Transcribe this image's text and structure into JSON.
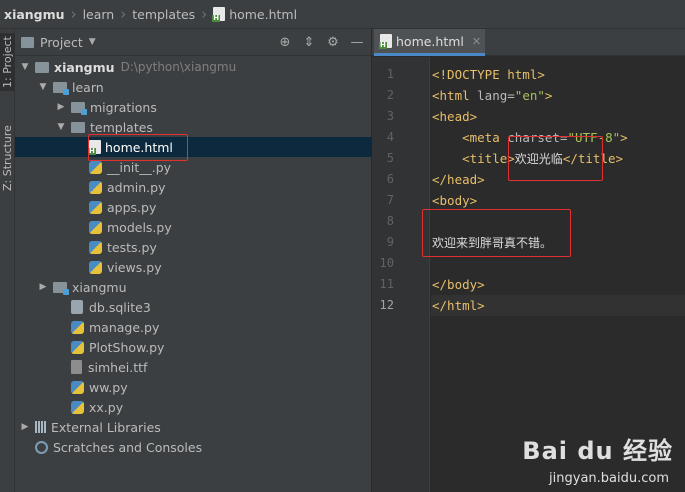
{
  "breadcrumb": [
    "xiangmu",
    "learn",
    "templates",
    "home.html"
  ],
  "tool_strip": {
    "project_tab": "1: Project",
    "structure_tab": "Z: Structure"
  },
  "project_panel": {
    "title": "Project",
    "tools": [
      "crosshair-icon",
      "collapse-icon",
      "gear-icon",
      "hide-icon"
    ]
  },
  "tree": [
    {
      "label": "xiangmu",
      "path": "D:\\python\\xiangmu",
      "indent": 0,
      "arrow": "down",
      "icon": "folder",
      "bold": true
    },
    {
      "label": "learn",
      "indent": 1,
      "arrow": "down",
      "icon": "folder-mod"
    },
    {
      "label": "migrations",
      "indent": 2,
      "arrow": "right",
      "icon": "folder-mod"
    },
    {
      "label": "templates",
      "indent": 2,
      "arrow": "down",
      "icon": "folder"
    },
    {
      "label": "home.html",
      "indent": 3,
      "arrow": "",
      "icon": "html",
      "selected": true
    },
    {
      "label": "__init__.py",
      "indent": 3,
      "arrow": "",
      "icon": "py"
    },
    {
      "label": "admin.py",
      "indent": 3,
      "arrow": "",
      "icon": "py"
    },
    {
      "label": "apps.py",
      "indent": 3,
      "arrow": "",
      "icon": "py"
    },
    {
      "label": "models.py",
      "indent": 3,
      "arrow": "",
      "icon": "py"
    },
    {
      "label": "tests.py",
      "indent": 3,
      "arrow": "",
      "icon": "py"
    },
    {
      "label": "views.py",
      "indent": 3,
      "arrow": "",
      "icon": "py"
    },
    {
      "label": "xiangmu",
      "indent": 1,
      "arrow": "right",
      "icon": "folder-mod"
    },
    {
      "label": "db.sqlite3",
      "indent": 2,
      "arrow": "",
      "icon": "db"
    },
    {
      "label": "manage.py",
      "indent": 2,
      "arrow": "",
      "icon": "py"
    },
    {
      "label": "PlotShow.py",
      "indent": 2,
      "arrow": "",
      "icon": "py"
    },
    {
      "label": "simhei.ttf",
      "indent": 2,
      "arrow": "",
      "icon": "ttf"
    },
    {
      "label": "ww.py",
      "indent": 2,
      "arrow": "",
      "icon": "py"
    },
    {
      "label": "xx.py",
      "indent": 2,
      "arrow": "",
      "icon": "py"
    },
    {
      "label": "External Libraries",
      "indent": 0,
      "arrow": "right",
      "icon": "lib"
    },
    {
      "label": "Scratches and Consoles",
      "indent": 0,
      "arrow": "",
      "icon": "scratch"
    }
  ],
  "editor": {
    "tab_label": "home.html",
    "current_line": 12,
    "lines": [
      [
        {
          "t": "<!DOCTYPE html>",
          "c": "tag"
        }
      ],
      [
        {
          "t": "<html ",
          "c": "tag"
        },
        {
          "t": "lang=",
          "c": "attr"
        },
        {
          "t": "\"en\"",
          "c": "str"
        },
        {
          "t": ">",
          "c": "tag"
        }
      ],
      [
        {
          "t": "<head>",
          "c": "tag"
        }
      ],
      [
        {
          "t": "    <meta ",
          "c": "tag"
        },
        {
          "t": "charset=",
          "c": "attr"
        },
        {
          "t": "\"UTF-8\"",
          "c": "str"
        },
        {
          "t": ">",
          "c": "tag"
        }
      ],
      [
        {
          "t": "    <title>",
          "c": "tag"
        },
        {
          "t": "欢迎光临",
          "c": "cn"
        },
        {
          "t": "</title>",
          "c": "tag"
        }
      ],
      [
        {
          "t": "</head>",
          "c": "tag"
        }
      ],
      [
        {
          "t": "<body>",
          "c": "tag"
        }
      ],
      [],
      [
        {
          "t": "欢迎来到胖哥真不错。",
          "c": "cn"
        }
      ],
      [],
      [
        {
          "t": "</body>",
          "c": "tag"
        }
      ],
      [
        {
          "t": "</html>",
          "c": "tag"
        }
      ]
    ]
  },
  "watermark": {
    "brand": "Bai du 经验",
    "url": "jingyan.baidu.com"
  }
}
